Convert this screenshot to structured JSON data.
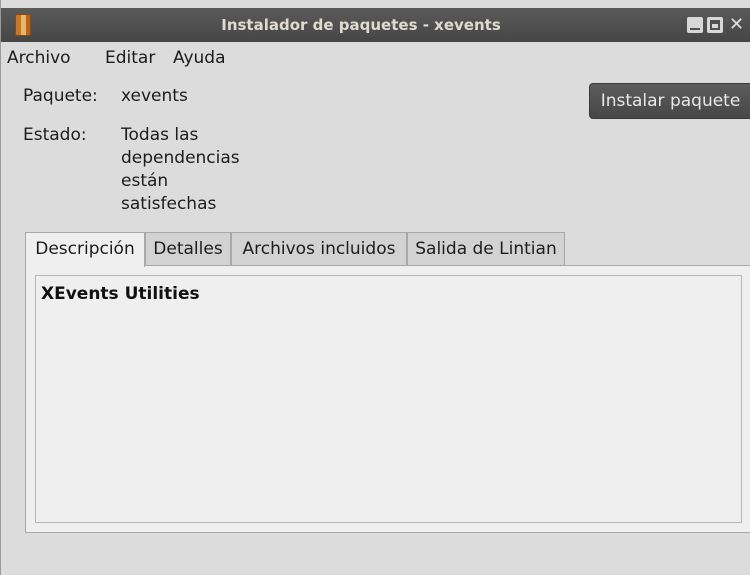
{
  "window": {
    "title": "Instalador de paquetes - xevents",
    "app_icon": "package-icon",
    "controls": {
      "minimize_icon": "minimize-icon",
      "maximize_icon": "maximize-icon",
      "close_symbol": "✕"
    }
  },
  "menubar": {
    "items": [
      {
        "label": "Archivo"
      },
      {
        "label": "Editar"
      },
      {
        "label": "Ayuda"
      }
    ]
  },
  "package": {
    "label": "Paquete:",
    "value": "xevents"
  },
  "status": {
    "label": "Estado:",
    "value": "Todas las dependencias están satisfechas"
  },
  "actions": {
    "install_label": "Instalar paquete"
  },
  "tabs": [
    {
      "label": "Descripción",
      "active": true
    },
    {
      "label": "Detalles",
      "active": false
    },
    {
      "label": "Archivos incluidos",
      "active": false
    },
    {
      "label": "Salida de Lintian",
      "active": false
    }
  ],
  "description": {
    "title": "XEvents Utilities"
  },
  "colors": {
    "titlebar": "#4f4f4f",
    "window_bg": "#dcdcdc",
    "button_bg": "#515151",
    "panel_bg": "#efefef"
  }
}
